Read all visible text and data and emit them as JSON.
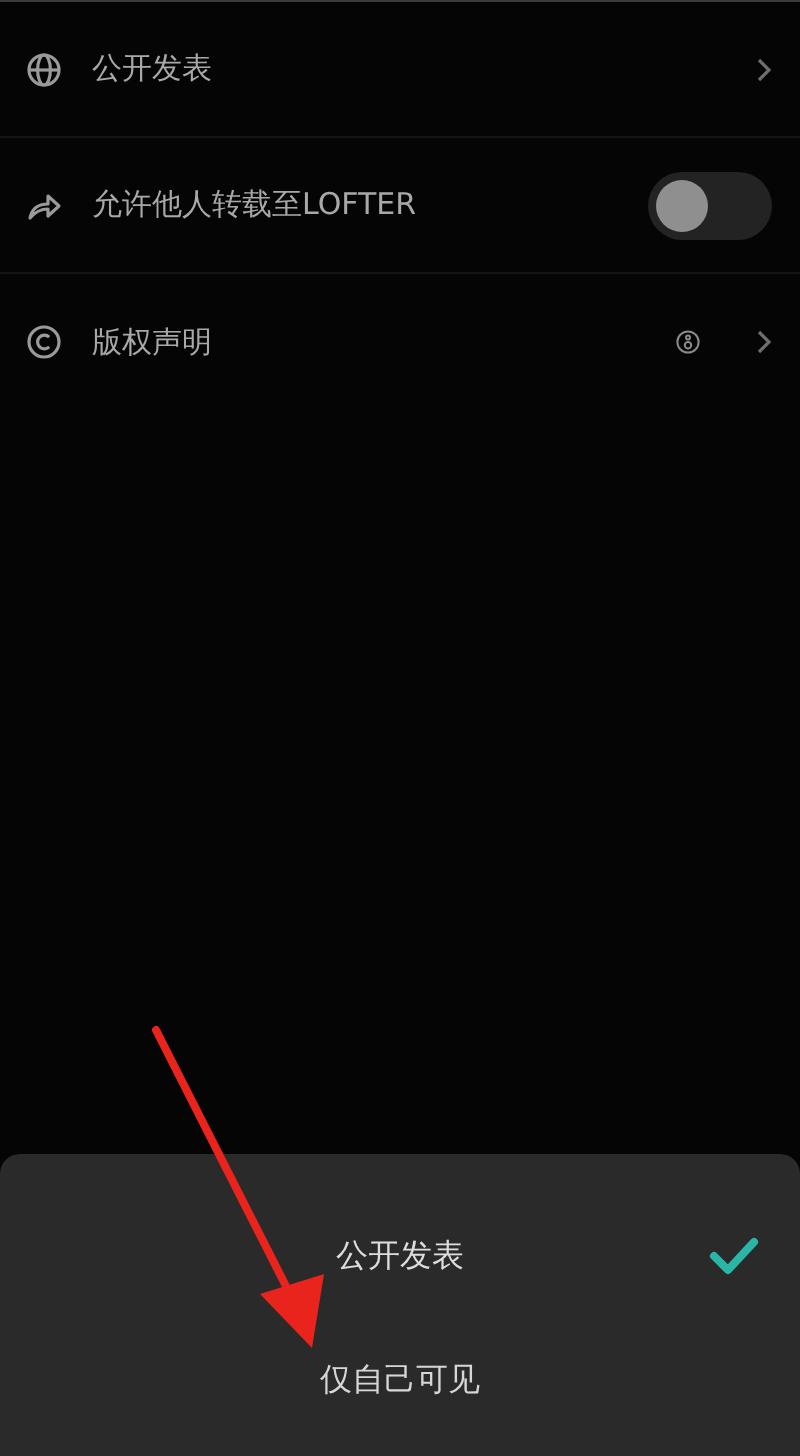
{
  "settings": [
    {
      "kind": "link",
      "label": "公开发表"
    },
    {
      "kind": "toggle",
      "label": "允许他人转载至LOFTER",
      "on": false
    },
    {
      "kind": "info-link",
      "label": "版权声明"
    }
  ],
  "sheet": {
    "options": [
      {
        "label": "公开发表",
        "selected": true
      },
      {
        "label": "仅自己可见",
        "selected": false
      }
    ]
  }
}
